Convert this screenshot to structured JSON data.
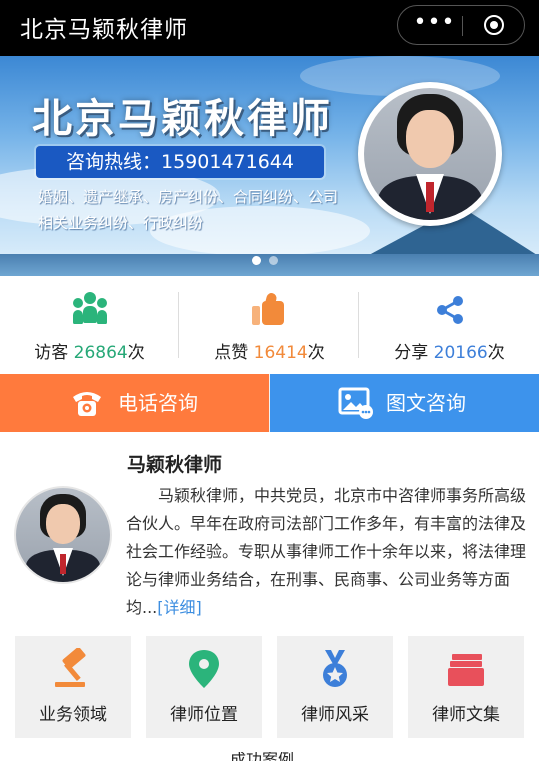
{
  "titlebar": {
    "title": "北京马颖秋律师",
    "more_glyph": "•••"
  },
  "banner": {
    "headline": "北京马颖秋律师",
    "hotline": "咨询热线：15901471644",
    "services": "婚姻、遗产继承、房产纠份、合同纠纷、公司相关业务纠纷、行政纠纷"
  },
  "stats": [
    {
      "prefix": "访客",
      "count": "26864",
      "suffix": "次",
      "icon": "users-icon",
      "color": "#2bb47b"
    },
    {
      "prefix": "点赞",
      "count": "16414",
      "suffix": "次",
      "icon": "thumbs-up-icon",
      "color": "#f28a3a"
    },
    {
      "prefix": "分享",
      "count": "20166",
      "suffix": "次",
      "icon": "share-icon",
      "color": "#3d7fd9"
    }
  ],
  "consult": {
    "phone_label": "电话咨询",
    "phone_color": "#ff7a3d",
    "picture_label": "图文咨询",
    "picture_color": "#3d93ec"
  },
  "profile": {
    "name": "马颖秋律师",
    "bio": "马颖秋律师，中共党员，北京市中咨律师事务所高级合伙人。早年在政府司法部门工作多年，有丰富的法律及社会工作经验。专职从事律师工作十余年以来，将法律理论与律师业务结合，在刑事、民商事、公司业务等方面均...",
    "more_link": "[详细]"
  },
  "features": [
    {
      "label": "业务领域",
      "icon": "gavel-icon"
    },
    {
      "label": "律师位置",
      "icon": "location-pin-icon"
    },
    {
      "label": "律师风采",
      "icon": "medal-icon"
    },
    {
      "label": "律师文集",
      "icon": "folder-stack-icon"
    }
  ],
  "next_section_title": "成功案例"
}
